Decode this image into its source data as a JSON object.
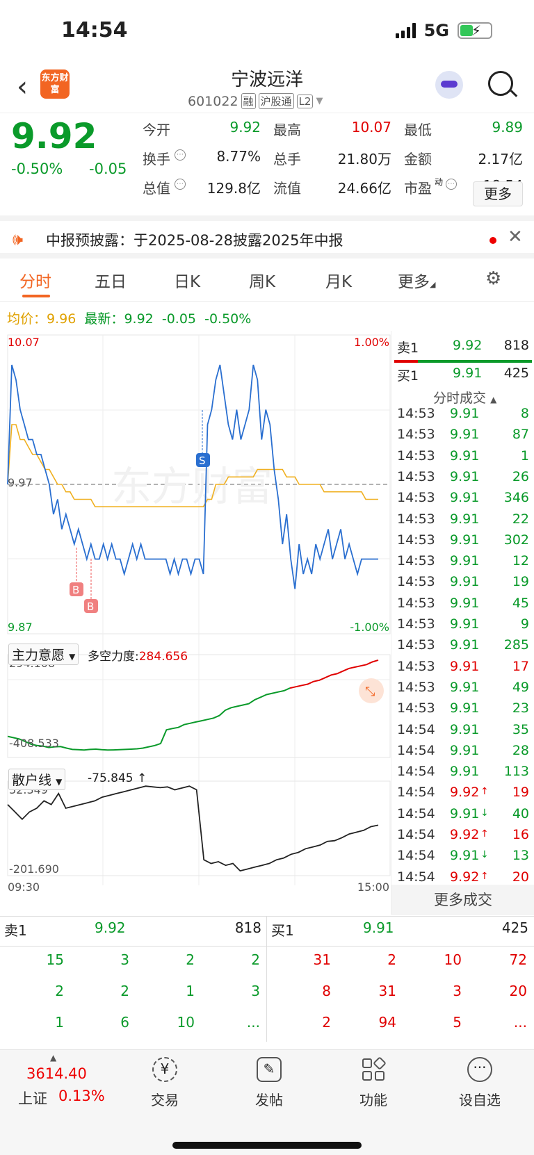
{
  "status": {
    "time": "14:54",
    "network": "5G"
  },
  "header": {
    "app_logo": "东方财富",
    "name": "宁波远洋",
    "code": "601022",
    "tags": [
      "融",
      "沪股通",
      "L2"
    ]
  },
  "quote": {
    "price": "9.92",
    "pct": "-0.50%",
    "chg": "-0.05",
    "fields": [
      {
        "label": "今开",
        "value": "9.92",
        "color": "#0a9a2a"
      },
      {
        "label": "最高",
        "value": "10.07",
        "color": "#e00000"
      },
      {
        "label": "最低",
        "value": "9.89",
        "color": "#0a9a2a"
      },
      {
        "label": "换手",
        "value": "8.77%",
        "color": "#222222"
      },
      {
        "label": "总手",
        "value": "21.80万",
        "color": "#222222"
      },
      {
        "label": "金额",
        "value": "2.17亿",
        "color": "#222222"
      },
      {
        "label": "总值",
        "value": "129.8亿",
        "color": "#222222"
      },
      {
        "label": "流值",
        "value": "24.66亿",
        "color": "#222222"
      },
      {
        "label": "市盈",
        "sup": "动",
        "value": "18.54",
        "color": "#222222"
      }
    ],
    "more": "更多"
  },
  "notice": {
    "text": "中报预披露：于2025-08-28披露2025年中报"
  },
  "tabs": [
    "分时",
    "五日",
    "日K",
    "周K",
    "月K",
    "更多"
  ],
  "avg_line": {
    "avg_label": "均价：",
    "avg": "9.96",
    "last_label": "最新：",
    "last": "9.92",
    "chg": "-0.05",
    "pct": "-0.50%"
  },
  "chart_labels": {
    "y_max": "10.07",
    "y_min": "9.87",
    "y_mid": "9.97",
    "pct_max": "1.00%",
    "pct_min": "-1.00%",
    "x_start": "09:30",
    "x_end": "15:00",
    "watermark": "东方财富",
    "marker_s": "S",
    "marker_b": "B"
  },
  "chart_data": {
    "type": "line",
    "ylim": [
      9.87,
      10.07
    ],
    "reference_price": 9.97,
    "series": [
      {
        "values": [
          9.97,
          10.05,
          10.04,
          10.02,
          10.01,
          10.0,
          10.0,
          9.99,
          9.99,
          9.98,
          9.97,
          9.95,
          9.96,
          9.94,
          9.95,
          9.94,
          9.93,
          9.94,
          9.93,
          9.92,
          9.93,
          9.92,
          9.92,
          9.93,
          9.92,
          9.93,
          9.92,
          9.92,
          9.91,
          9.92,
          9.93,
          9.92,
          9.93,
          9.92,
          9.92,
          9.92,
          9.92,
          9.92,
          9.92,
          9.91,
          9.92,
          9.91,
          9.92,
          9.92,
          9.91,
          9.92,
          9.92,
          9.91,
          10.01,
          10.02,
          10.04,
          10.05,
          10.03,
          10.01,
          10.0,
          10.02,
          10.0,
          10.01,
          10.02,
          10.05,
          10.04,
          10.0,
          10.02,
          10.01,
          9.98,
          9.96,
          9.93,
          9.95,
          9.92,
          9.9,
          9.93,
          9.91,
          9.92,
          9.91,
          9.93,
          9.92,
          9.93,
          9.94,
          9.92,
          9.93,
          9.94,
          9.92,
          9.93,
          9.92,
          9.91,
          9.92,
          9.92,
          9.92,
          9.92,
          9.92
        ]
      },
      {
        "values": [
          9.97,
          10.01,
          10.01,
          10.0,
          10.0,
          9.995,
          9.99,
          9.99,
          9.985,
          9.98,
          9.98,
          9.975,
          9.97,
          9.97,
          9.965,
          9.965,
          9.96,
          9.96,
          9.96,
          9.96,
          9.96,
          9.955,
          9.955,
          9.955,
          9.955,
          9.955,
          9.955,
          9.955,
          9.955,
          9.955,
          9.955,
          9.955,
          9.955,
          9.955,
          9.955,
          9.955,
          9.955,
          9.955,
          9.955,
          9.955,
          9.955,
          9.955,
          9.955,
          9.955,
          9.955,
          9.955,
          9.955,
          9.955,
          9.96,
          9.96,
          9.97,
          9.97,
          9.97,
          9.975,
          9.975,
          9.975,
          9.975,
          9.975,
          9.975,
          9.975,
          9.98,
          9.98,
          9.98,
          9.98,
          9.98,
          9.98,
          9.98,
          9.975,
          9.975,
          9.975,
          9.97,
          9.97,
          9.97,
          9.97,
          9.97,
          9.97,
          9.965,
          9.965,
          9.965,
          9.965,
          9.965,
          9.965,
          9.965,
          9.965,
          9.965,
          9.965,
          9.96,
          9.96,
          9.96,
          9.96
        ]
      }
    ]
  },
  "indicator1": {
    "name": "主力意愿",
    "label": "多空力度:",
    "value": "284.656",
    "max": "294.108",
    "min": "-408.533"
  },
  "indicator1_data": {
    "type": "line",
    "ylim": [
      -408.533,
      294.108
    ],
    "values": [
      -300,
      -310,
      -320,
      -340,
      -360,
      -370,
      -375,
      -385,
      -380,
      -378,
      -390,
      -400,
      -402,
      -405,
      -400,
      -398,
      -402,
      -405,
      -404,
      -402,
      -400,
      -398,
      -395,
      -390,
      -380,
      -370,
      -355,
      -250,
      -240,
      -232,
      -210,
      -200,
      -190,
      -180,
      -170,
      -160,
      -140,
      -100,
      -80,
      -70,
      -60,
      -50,
      -20,
      0,
      20,
      30,
      40,
      50,
      70,
      80,
      90,
      100,
      120,
      130,
      150,
      170,
      180,
      200,
      220,
      230,
      240,
      250,
      270,
      284
    ]
  },
  "indicator2": {
    "name": "散户线",
    "value": "-75.845 ↑",
    "max": "32.349",
    "min": "-201.690"
  },
  "indicator2_data": {
    "type": "line",
    "ylim": [
      -201.69,
      32.349
    ],
    "values": [
      -20,
      -40,
      -60,
      -40,
      -30,
      -10,
      -20,
      10,
      -30,
      -25,
      -20,
      -15,
      -10,
      0,
      5,
      10,
      15,
      20,
      25,
      30,
      28,
      26,
      28,
      20,
      25,
      30,
      20,
      -170,
      -180,
      -175,
      -185,
      -180,
      -200,
      -195,
      -190,
      -185,
      -180,
      -170,
      -165,
      -155,
      -150,
      -140,
      -135,
      -130,
      -120,
      -118,
      -110,
      -100,
      -95,
      -90,
      -80,
      -76
    ]
  },
  "order_book": {
    "sell_label": "卖1",
    "sell_price": "9.92",
    "sell_vol": "818",
    "buy_label": "买1",
    "buy_price": "9.91",
    "buy_vol": "425",
    "ticks_title": "分时成交",
    "ticks": [
      {
        "time": "14:53",
        "price": "9.91",
        "vol": "8",
        "color": "#0a9a2a",
        "arrow": ""
      },
      {
        "time": "14:53",
        "price": "9.91",
        "vol": "87",
        "color": "#0a9a2a",
        "arrow": ""
      },
      {
        "time": "14:53",
        "price": "9.91",
        "vol": "1",
        "color": "#0a9a2a",
        "arrow": ""
      },
      {
        "time": "14:53",
        "price": "9.91",
        "vol": "26",
        "color": "#0a9a2a",
        "arrow": ""
      },
      {
        "time": "14:53",
        "price": "9.91",
        "vol": "346",
        "color": "#0a9a2a",
        "arrow": ""
      },
      {
        "time": "14:53",
        "price": "9.91",
        "vol": "22",
        "color": "#0a9a2a",
        "arrow": ""
      },
      {
        "time": "14:53",
        "price": "9.91",
        "vol": "302",
        "color": "#0a9a2a",
        "arrow": ""
      },
      {
        "time": "14:53",
        "price": "9.91",
        "vol": "12",
        "color": "#0a9a2a",
        "arrow": ""
      },
      {
        "time": "14:53",
        "price": "9.91",
        "vol": "19",
        "color": "#0a9a2a",
        "arrow": ""
      },
      {
        "time": "14:53",
        "price": "9.91",
        "vol": "45",
        "color": "#0a9a2a",
        "arrow": ""
      },
      {
        "time": "14:53",
        "price": "9.91",
        "vol": "9",
        "color": "#0a9a2a",
        "arrow": ""
      },
      {
        "time": "14:53",
        "price": "9.91",
        "vol": "285",
        "color": "#0a9a2a",
        "arrow": ""
      },
      {
        "time": "14:53",
        "price": "9.91",
        "vol": "17",
        "color": "#e00000",
        "arrow": ""
      },
      {
        "time": "14:53",
        "price": "9.91",
        "vol": "49",
        "color": "#0a9a2a",
        "arrow": ""
      },
      {
        "time": "14:53",
        "price": "9.91",
        "vol": "23",
        "color": "#0a9a2a",
        "arrow": ""
      },
      {
        "time": "14:54",
        "price": "9.91",
        "vol": "35",
        "color": "#0a9a2a",
        "arrow": ""
      },
      {
        "time": "14:54",
        "price": "9.91",
        "vol": "28",
        "color": "#0a9a2a",
        "arrow": ""
      },
      {
        "time": "14:54",
        "price": "9.91",
        "vol": "113",
        "color": "#0a9a2a",
        "arrow": ""
      },
      {
        "time": "14:54",
        "price": "9.92",
        "vol": "19",
        "color": "#e00000",
        "arrow": "↑"
      },
      {
        "time": "14:54",
        "price": "9.91",
        "vol": "40",
        "color": "#0a9a2a",
        "arrow": "↓"
      },
      {
        "time": "14:54",
        "price": "9.92",
        "vol": "16",
        "color": "#e00000",
        "arrow": "↑"
      },
      {
        "time": "14:54",
        "price": "9.91",
        "vol": "13",
        "color": "#0a9a2a",
        "arrow": "↓"
      },
      {
        "time": "14:54",
        "price": "9.92",
        "vol": "20",
        "color": "#e00000",
        "arrow": "↑"
      }
    ],
    "more_deals": "更多成交"
  },
  "depth": {
    "sell": {
      "label": "卖1",
      "price": "9.92",
      "vol": "818",
      "rows": [
        [
          "15",
          "3",
          "2",
          "2"
        ],
        [
          "2",
          "2",
          "1",
          "3"
        ],
        [
          "1",
          "6",
          "10",
          "..."
        ]
      ]
    },
    "buy": {
      "label": "买1",
      "price": "9.91",
      "vol": "425",
      "rows": [
        [
          "31",
          "2",
          "10",
          "72"
        ],
        [
          "8",
          "31",
          "3",
          "20"
        ],
        [
          "2",
          "94",
          "5",
          "..."
        ]
      ]
    }
  },
  "bottom_nav": {
    "index_value": "3614.40",
    "index_name": "上证",
    "index_pct": "0.13%",
    "items": [
      {
        "label": "交易",
        "icon": "yen-cycle-icon"
      },
      {
        "label": "发帖",
        "icon": "edit-icon"
      },
      {
        "label": "功能",
        "icon": "grid-icon"
      },
      {
        "label": "设自选",
        "icon": "more-dots-icon"
      }
    ]
  },
  "colors": {
    "up": "#e00000",
    "down": "#0a9a2a",
    "accent": "#f26522",
    "avg_line": "#f0b020",
    "price_line": "#2a6fd0"
  }
}
